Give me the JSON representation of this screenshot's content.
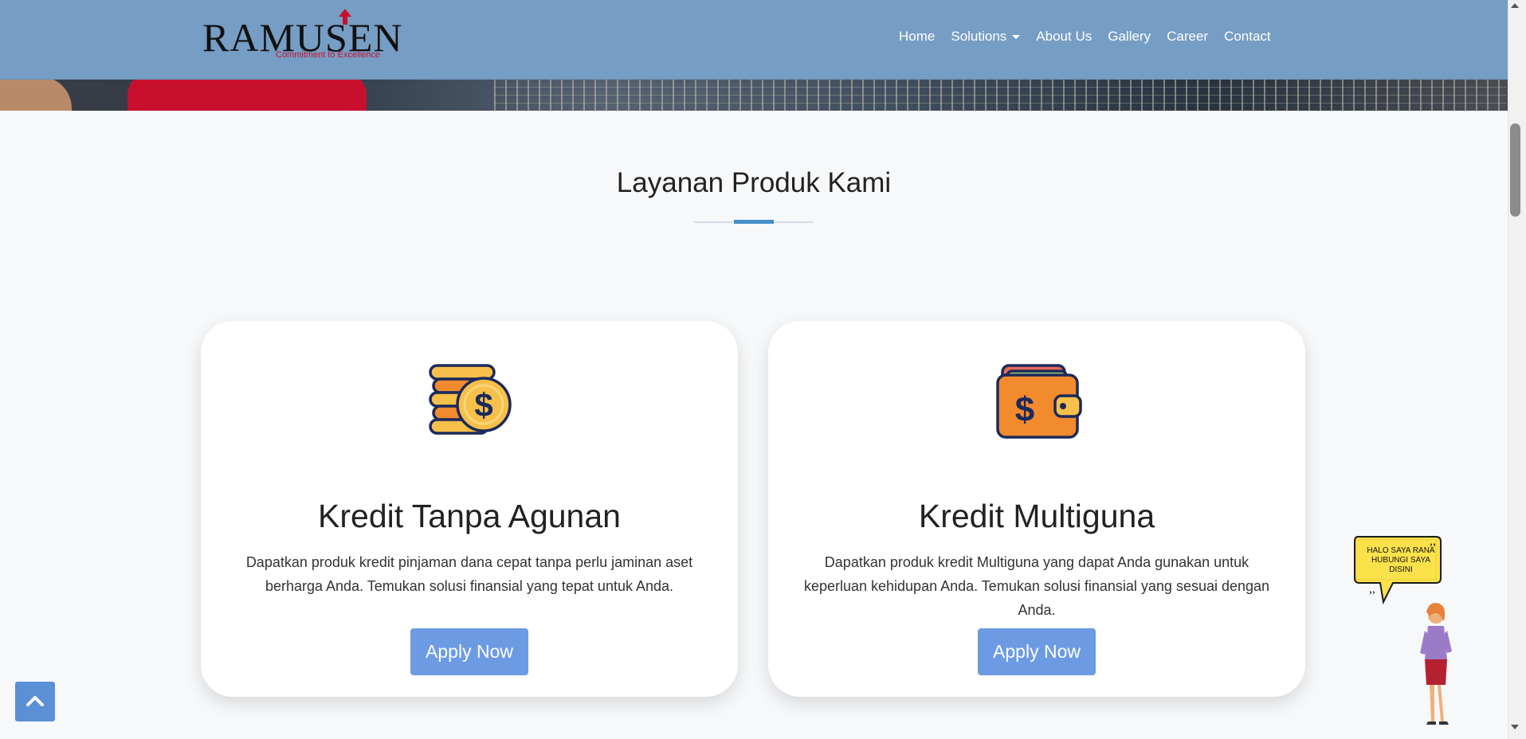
{
  "brand": {
    "logo_text": "RAMUSEN",
    "tagline": "Commitment to Excellence"
  },
  "nav": {
    "items": [
      {
        "label": "Home"
      },
      {
        "label": "Solutions",
        "has_dropdown": true
      },
      {
        "label": "About Us"
      },
      {
        "label": "Gallery"
      },
      {
        "label": "Career"
      },
      {
        "label": "Contact"
      }
    ]
  },
  "section": {
    "title": "Layanan Produk Kami"
  },
  "cards": [
    {
      "icon": "coins-dollar-icon",
      "title": "Kredit Tanpa Agunan",
      "description": "Dapatkan produk kredit pinjaman dana cepat tanpa perlu jaminan aset berharga Anda. Temukan solusi finansial yang tepat untuk Anda.",
      "button_label": "Apply Now"
    },
    {
      "icon": "wallet-dollar-icon",
      "title": "Kredit Multiguna",
      "description": "Dapatkan produk kredit Multiguna yang dapat Anda gunakan untuk keperluan kehidupan Anda. Temukan solusi finansial yang sesuai dengan Anda.",
      "button_label": "Apply Now"
    }
  ],
  "assistant": {
    "bubble_text": "HALO SAYA RANA HUBUNGI SAYA DISINI"
  },
  "colors": {
    "navbar": "#769dc4",
    "accent": "#4a90c8",
    "button": "#6c9be3",
    "back_to_top": "#5b8fd6",
    "brand_red": "#c8102e"
  },
  "icons": {
    "back_to_top": "chevron-up-icon",
    "logo_arrow": "arrow-up-icon"
  }
}
